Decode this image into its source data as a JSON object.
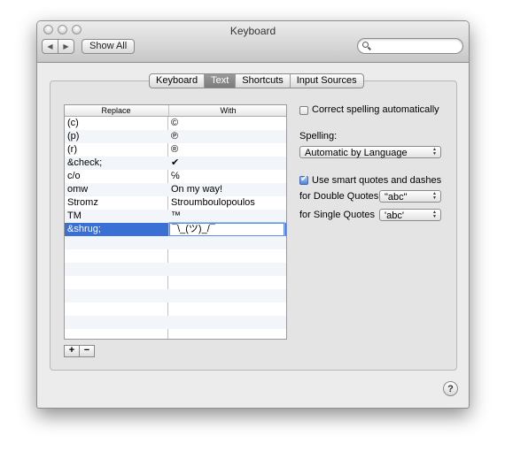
{
  "window": {
    "title": "Keyboard"
  },
  "toolbar": {
    "back_glyph": "◀",
    "forward_glyph": "▶",
    "show_all_label": "Show All",
    "search_placeholder": ""
  },
  "tabs": [
    {
      "label": "Keyboard",
      "selected": false
    },
    {
      "label": "Text",
      "selected": true
    },
    {
      "label": "Shortcuts",
      "selected": false
    },
    {
      "label": "Input Sources",
      "selected": false
    }
  ],
  "table": {
    "headers": {
      "replace": "Replace",
      "with": "With"
    },
    "rows": [
      {
        "replace": "(c)",
        "with": "©"
      },
      {
        "replace": "(p)",
        "with": "℗"
      },
      {
        "replace": "(r)",
        "with": "®"
      },
      {
        "replace": "&check;",
        "with": "✔"
      },
      {
        "replace": "c/o",
        "with": "℅"
      },
      {
        "replace": "omw",
        "with": "On my way!"
      },
      {
        "replace": "Stromz",
        "with": "Stroumboulopoulos"
      },
      {
        "replace": "TM",
        "with": "™"
      },
      {
        "replace": "&shrug;",
        "with": "¯\\_(ツ)_/¯",
        "selected": true,
        "editing": true
      }
    ]
  },
  "buttons": {
    "add": "+",
    "remove": "−"
  },
  "settings": {
    "correct_spelling": {
      "label": "Correct spelling automatically",
      "checked": false
    },
    "spelling_label": "Spelling:",
    "spelling_value": "Automatic by Language",
    "smart_quotes": {
      "label": "Use smart quotes and dashes",
      "checked": true
    },
    "double_quotes_label": "for Double Quotes",
    "double_quotes_value": "\"abc\"",
    "single_quotes_label": "for Single Quotes",
    "single_quotes_value": "'abc'"
  },
  "help_glyph": "?",
  "colors": {
    "selection": "#3a6fd6",
    "checkbox_checked": "#4d86d8"
  }
}
